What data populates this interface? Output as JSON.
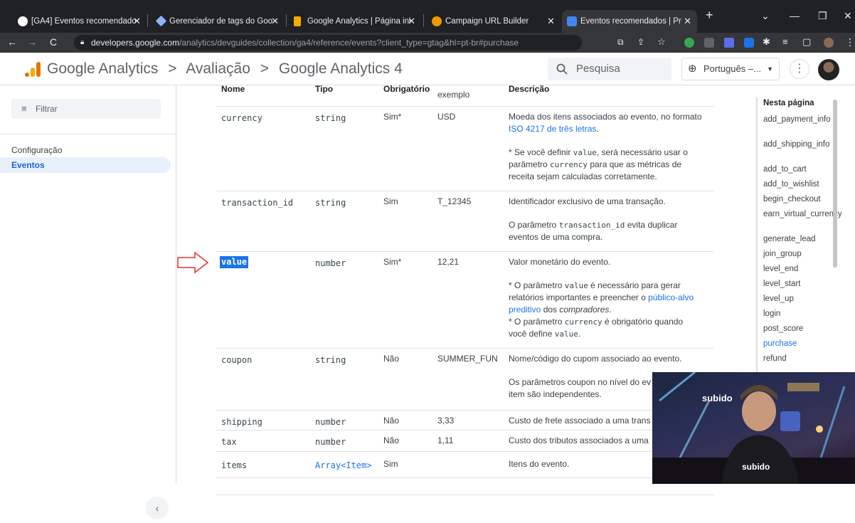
{
  "browser": {
    "tabs": [
      {
        "title": "[GA4] Eventos recomendado",
        "fav_color": "#ffffff"
      },
      {
        "title": "Gerenciador de tags do Goo",
        "fav_color": "#8ab4f8"
      },
      {
        "title": "Google Analytics | Página ini",
        "fav_color": "#f9ab00"
      },
      {
        "title": "Campaign URL Builder",
        "fav_color": "#f29900"
      },
      {
        "title": "Eventos recomendados | Pr",
        "fav_color": "#4285f4"
      }
    ],
    "url_domain": "developers.google.com",
    "url_path": "/analytics/devguides/collection/ga4/reference/events?client_type=gtag&hl=pt-br#purchase"
  },
  "header": {
    "brand": "Google Analytics",
    "crumb1": "Avaliação",
    "crumb2": "Google Analytics 4",
    "sep": ">",
    "search_placeholder": "Pesquisa",
    "language": "Português –...",
    "logo_colors": [
      "#f9ab00",
      "#e37400"
    ]
  },
  "sidebar": {
    "filter_placeholder": "Filtrar",
    "items": [
      {
        "label": "Configuração"
      },
      {
        "label": "Eventos"
      }
    ],
    "collapse_glyph": "‹"
  },
  "table": {
    "headers": {
      "name": "Nome",
      "type": "Tipo",
      "required": "Obrigatório",
      "example": "exemplo",
      "description": "Descrição"
    },
    "rows": [
      {
        "name": "currency",
        "type": "string",
        "required": "Sim*",
        "example": "USD",
        "d1": "Moeda dos itens associados ao evento, no formato",
        "d1_link": "ISO 4217 de três letras",
        "d1_end": ".",
        "d2a": "* Se você definir ",
        "d2_code": "value",
        "d2b": ", será necessário usar o",
        "d3a": "parâmetro ",
        "d3_code": "currency",
        "d3b": " para que as métricas de",
        "d4": "receita sejam calculadas corretamente."
      },
      {
        "name": "transaction_id",
        "type": "string",
        "required": "Sim",
        "example": "T_12345",
        "d1": "Identificador exclusivo de uma transação.",
        "d2a": "O parâmetro ",
        "d2_code": "transaction_id",
        "d2b": " evita duplicar",
        "d3": "eventos de uma compra."
      },
      {
        "name": "value",
        "type": "number",
        "required": "Sim*",
        "example": "12,21",
        "d1": "Valor monetário do evento.",
        "d2a": "* O parâmetro ",
        "d2_code": "value",
        "d2b": " é necessário para gerar",
        "d3a": "relatórios importantes e preencher o ",
        "d3_link": "público-alvo",
        "d4_link": "preditivo",
        "d4a": " dos ",
        "d4_em": "compradores",
        "d4b": ".",
        "d5a": "* O parâmetro ",
        "d5_code": "currency",
        "d5b": " é obrigatório quando",
        "d6a": "você define ",
        "d6_code": "value",
        "d6b": "."
      },
      {
        "name": "coupon",
        "type": "string",
        "required": "Não",
        "example": "SUMMER_FUN",
        "d1": "Nome/código do cupom associado ao evento.",
        "d2": "Os parâmetros coupon no nível do ev",
        "d3": "item são independentes."
      },
      {
        "name": "shipping",
        "type": "number",
        "required": "Não",
        "example": "3,33",
        "d1": "Custo de frete associado a uma trans"
      },
      {
        "name": "tax",
        "type": "number",
        "required": "Não",
        "example": "1,11",
        "d1": "Custo dos tributos associados a uma"
      },
      {
        "name": "items",
        "type": "Array<Item>",
        "required": "Sim",
        "example": "",
        "d1": "Itens do evento."
      }
    ]
  },
  "toc": {
    "title": "Nesta página",
    "items": [
      "add_payment_info",
      "add_shipping_info",
      "add_to_cart",
      "add_to_wishlist",
      "begin_checkout",
      "earn_virtual_currency",
      "generate_lead",
      "join_group",
      "level_end",
      "level_start",
      "level_up",
      "login",
      "post_score",
      "purchase",
      "refund"
    ],
    "selected": "purchase"
  },
  "webcam": {
    "sign_text": "subido",
    "shirt_text": "subido"
  }
}
